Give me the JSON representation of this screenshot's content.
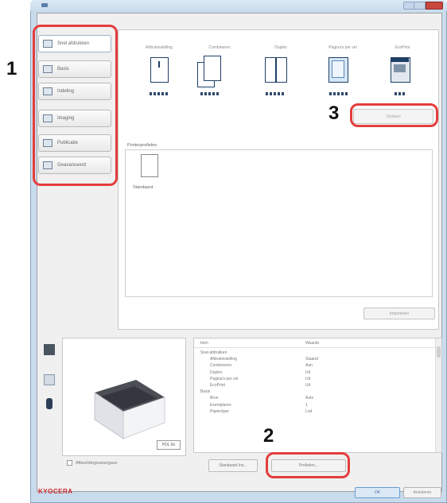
{
  "tabs": [
    {
      "label": "Snel afdrukken",
      "icon": "quick-print-icon"
    },
    {
      "label": "Basis",
      "icon": "basic-icon"
    },
    {
      "label": "Indeling",
      "icon": "layout-icon"
    },
    {
      "label": "Imaging",
      "icon": "imaging-icon"
    },
    {
      "label": "Publicatie",
      "icon": "publishing-icon"
    },
    {
      "label": "Geavanceerd",
      "icon": "advanced-icon"
    }
  ],
  "layouts": [
    {
      "label": "Afdrukinstelling"
    },
    {
      "label": "Combineren"
    },
    {
      "label": "Duplex"
    },
    {
      "label": "Pagina's per vel"
    },
    {
      "label": "EcoPrint"
    }
  ],
  "top_save_button": "Opslaan",
  "profiles_group": {
    "label": "Printerprofielen",
    "profile_name": "Standaard",
    "import_button": "Importeren"
  },
  "preview": {
    "zoom_label": "PDL 8x",
    "checkbox_label": "Afbeeldingsweergave"
  },
  "settings": {
    "header_item": "Item",
    "header_value": "Waarde",
    "rows": [
      {
        "item": "Snel afdrukken",
        "value": "",
        "indent": 0
      },
      {
        "item": "Afdrukinstelling",
        "value": "Staand",
        "indent": 1
      },
      {
        "item": "Combineren",
        "value": "Aan",
        "indent": 1
      },
      {
        "item": "Duplex",
        "value": "Uit",
        "indent": 1
      },
      {
        "item": "Pagina's per vel",
        "value": "Uit",
        "indent": 1
      },
      {
        "item": "EcoPrint",
        "value": "Uit",
        "indent": 1
      },
      {
        "item": "Basis",
        "value": "",
        "indent": 0
      },
      {
        "item": "Bron",
        "value": "Auto",
        "indent": 1
      },
      {
        "item": "Exemplaren",
        "value": "1",
        "indent": 1
      },
      {
        "item": "Papiertype",
        "value": "Lnd",
        "indent": 1
      }
    ]
  },
  "bottom_buttons": {
    "default": "Standaard Ins...",
    "save": "Profielen..."
  },
  "brand": "KYOCERA",
  "ok_button": "OK",
  "cancel_button": "Annuleren",
  "callouts": [
    "1",
    "2",
    "3"
  ],
  "colors": {
    "callout": "#e43d3d",
    "brand": "#c8262d"
  }
}
